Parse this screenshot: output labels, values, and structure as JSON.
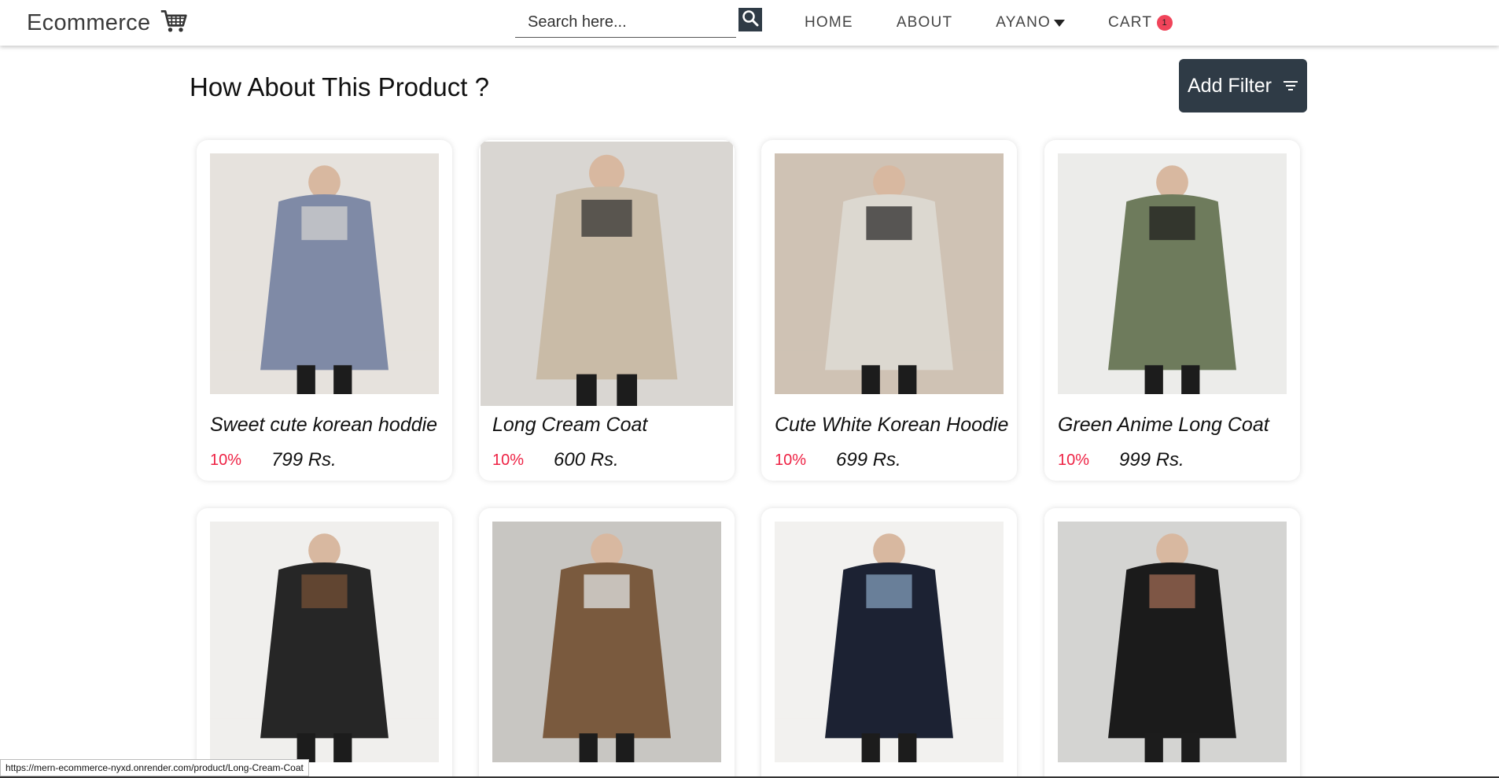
{
  "navbar": {
    "brand": "Ecommerce",
    "search_placeholder": "Search here...",
    "links": [
      {
        "label": "HOME"
      },
      {
        "label": "ABOUT"
      },
      {
        "label": "AYANO"
      },
      {
        "label": "CART"
      }
    ],
    "cart_count": "1"
  },
  "main": {
    "title": "How About This Product ?",
    "filter_label": "Add Filter"
  },
  "products": [
    {
      "name": "Sweet cute korean hoddie",
      "discount": "10%",
      "price": "799 Rs.",
      "colors": {
        "bg": "#e6e2dd",
        "item": "#7f8aa6",
        "accent": "#d7d6d3"
      }
    },
    {
      "name": "Long Cream Coat",
      "discount": "10%",
      "price": "600 Rs.",
      "colors": {
        "bg": "#d9d6d2",
        "item": "#c9bba7",
        "accent": "#2a2a2a"
      }
    },
    {
      "name": "Cute White Korean Hoodie",
      "discount": "10%",
      "price": "699 Rs.",
      "colors": {
        "bg": "#cfc2b4",
        "item": "#dcd8d0",
        "accent": "#1e1e1e"
      }
    },
    {
      "name": "Green Anime Long Coat",
      "discount": "10%",
      "price": "999 Rs.",
      "colors": {
        "bg": "#ececea",
        "item": "#6e7b5c",
        "accent": "#1a1a1a"
      }
    },
    {
      "name": "",
      "discount": "",
      "price": "",
      "colors": {
        "bg": "#f0efed",
        "item": "#262626",
        "accent": "#7a5236"
      }
    },
    {
      "name": "",
      "discount": "",
      "price": "",
      "colors": {
        "bg": "#c8c6c2",
        "item": "#7a5a3e",
        "accent": "#e8ecf0"
      }
    },
    {
      "name": "",
      "discount": "",
      "price": "",
      "colors": {
        "bg": "#f2f1ef",
        "item": "#1c2233",
        "accent": "#8aa6c4"
      }
    },
    {
      "name": "",
      "discount": "",
      "price": "",
      "colors": {
        "bg": "#d4d4d2",
        "item": "#1b1b1b",
        "accent": "#a86f57"
      }
    }
  ],
  "status_url": "https://mern-ecommerce-nyxd.onrender.com/product/Long-Cream-Coat"
}
